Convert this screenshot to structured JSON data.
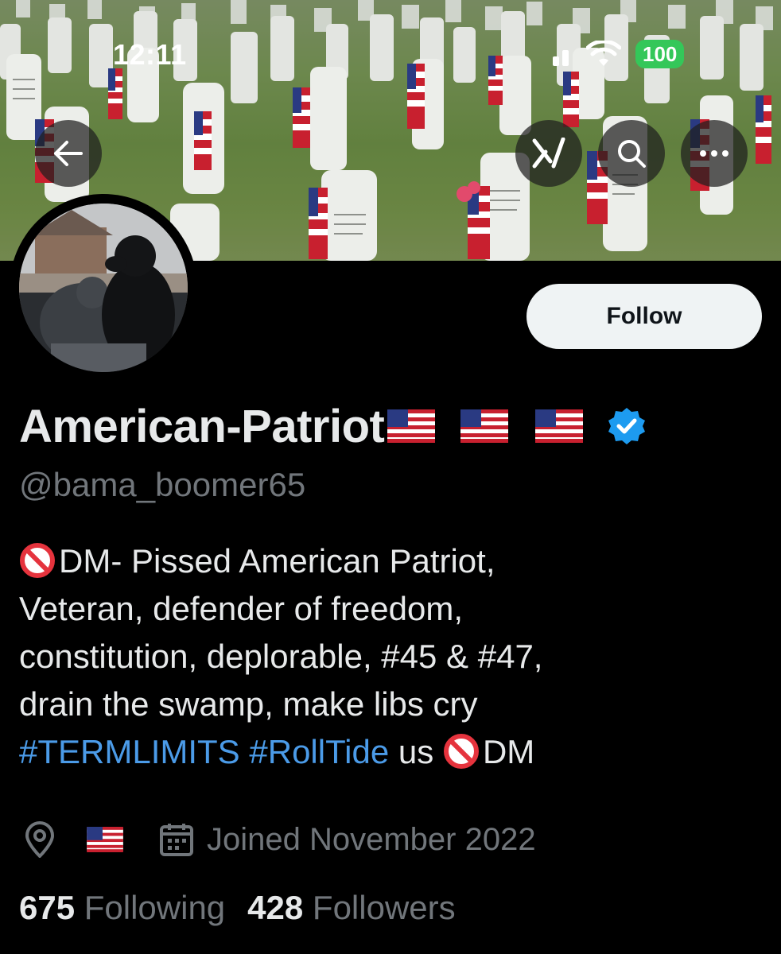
{
  "status_bar": {
    "time": "12:11",
    "battery": "100"
  },
  "header": {
    "back_icon": "arrow-left-icon",
    "grok_icon": "grok-icon",
    "search_icon": "search-icon",
    "more_icon": "more-icon"
  },
  "profile": {
    "display_name": "American-Patriot",
    "name_flags": [
      "🇺🇸",
      "🇺🇸",
      "🇺🇸"
    ],
    "verified": true,
    "handle": "@bama_boomer65",
    "follow_label": "Follow",
    "bio": {
      "line1_text": "DM- Pissed American Patriot,",
      "line2": "Veteran, defender of freedom,",
      "line3": "constitution, deplorable, #45 & #47,",
      "line4": "drain the swamp, make libs cry",
      "hashtag1": "#TERMLIMITS",
      "hashtag2": "#RollTide",
      "line5_mid": " us ",
      "line5_end": "DM"
    },
    "location_flag": "🇺🇸",
    "joined": "Joined November 2022",
    "following_count": "675",
    "following_label": "Following",
    "followers_count": "428",
    "followers_label": "Followers"
  },
  "colors": {
    "background": "#000000",
    "text": "#e7e9ea",
    "secondary_text": "#71767b",
    "link": "#4b9be8",
    "verified": "#1d9bf0",
    "battery": "#34c759"
  }
}
